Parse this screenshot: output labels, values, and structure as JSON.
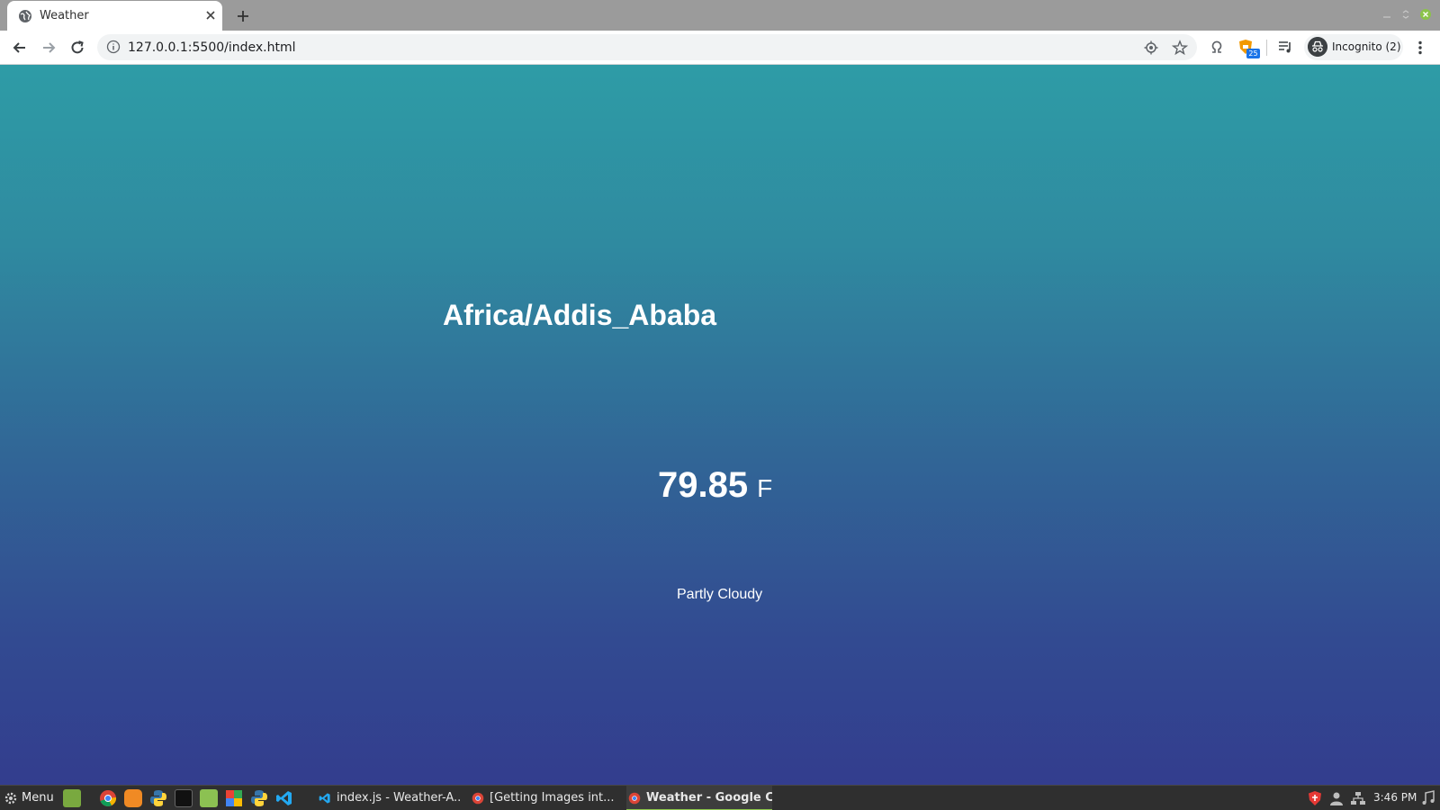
{
  "browser": {
    "tab": {
      "title": "Weather",
      "favicon": "globe-icon"
    },
    "address_bar": {
      "url": "127.0.0.1:5500/index.html"
    },
    "profile": {
      "label": "Incognito (2)"
    },
    "extension_badge": "25"
  },
  "weather": {
    "location": "Africa/Addis_Ababa",
    "temperature": "79.85",
    "unit": "F",
    "description": "Partly Cloudy"
  },
  "taskbar": {
    "menu_label": "Menu",
    "tasks": [
      {
        "label": "index.js - Weather-A...",
        "icon": "vscode-icon"
      },
      {
        "label": "[Getting Images int...",
        "icon": "chrome-icon"
      },
      {
        "label": "Weather - Google Ch...",
        "icon": "chrome-icon"
      }
    ],
    "clock": "3:46 PM"
  },
  "colors": {
    "gradient_top": "#2e9ca6",
    "gradient_bottom": "#333d8e",
    "tab_strip": "#9b9b9b",
    "taskbar": "#2f2f2f"
  }
}
